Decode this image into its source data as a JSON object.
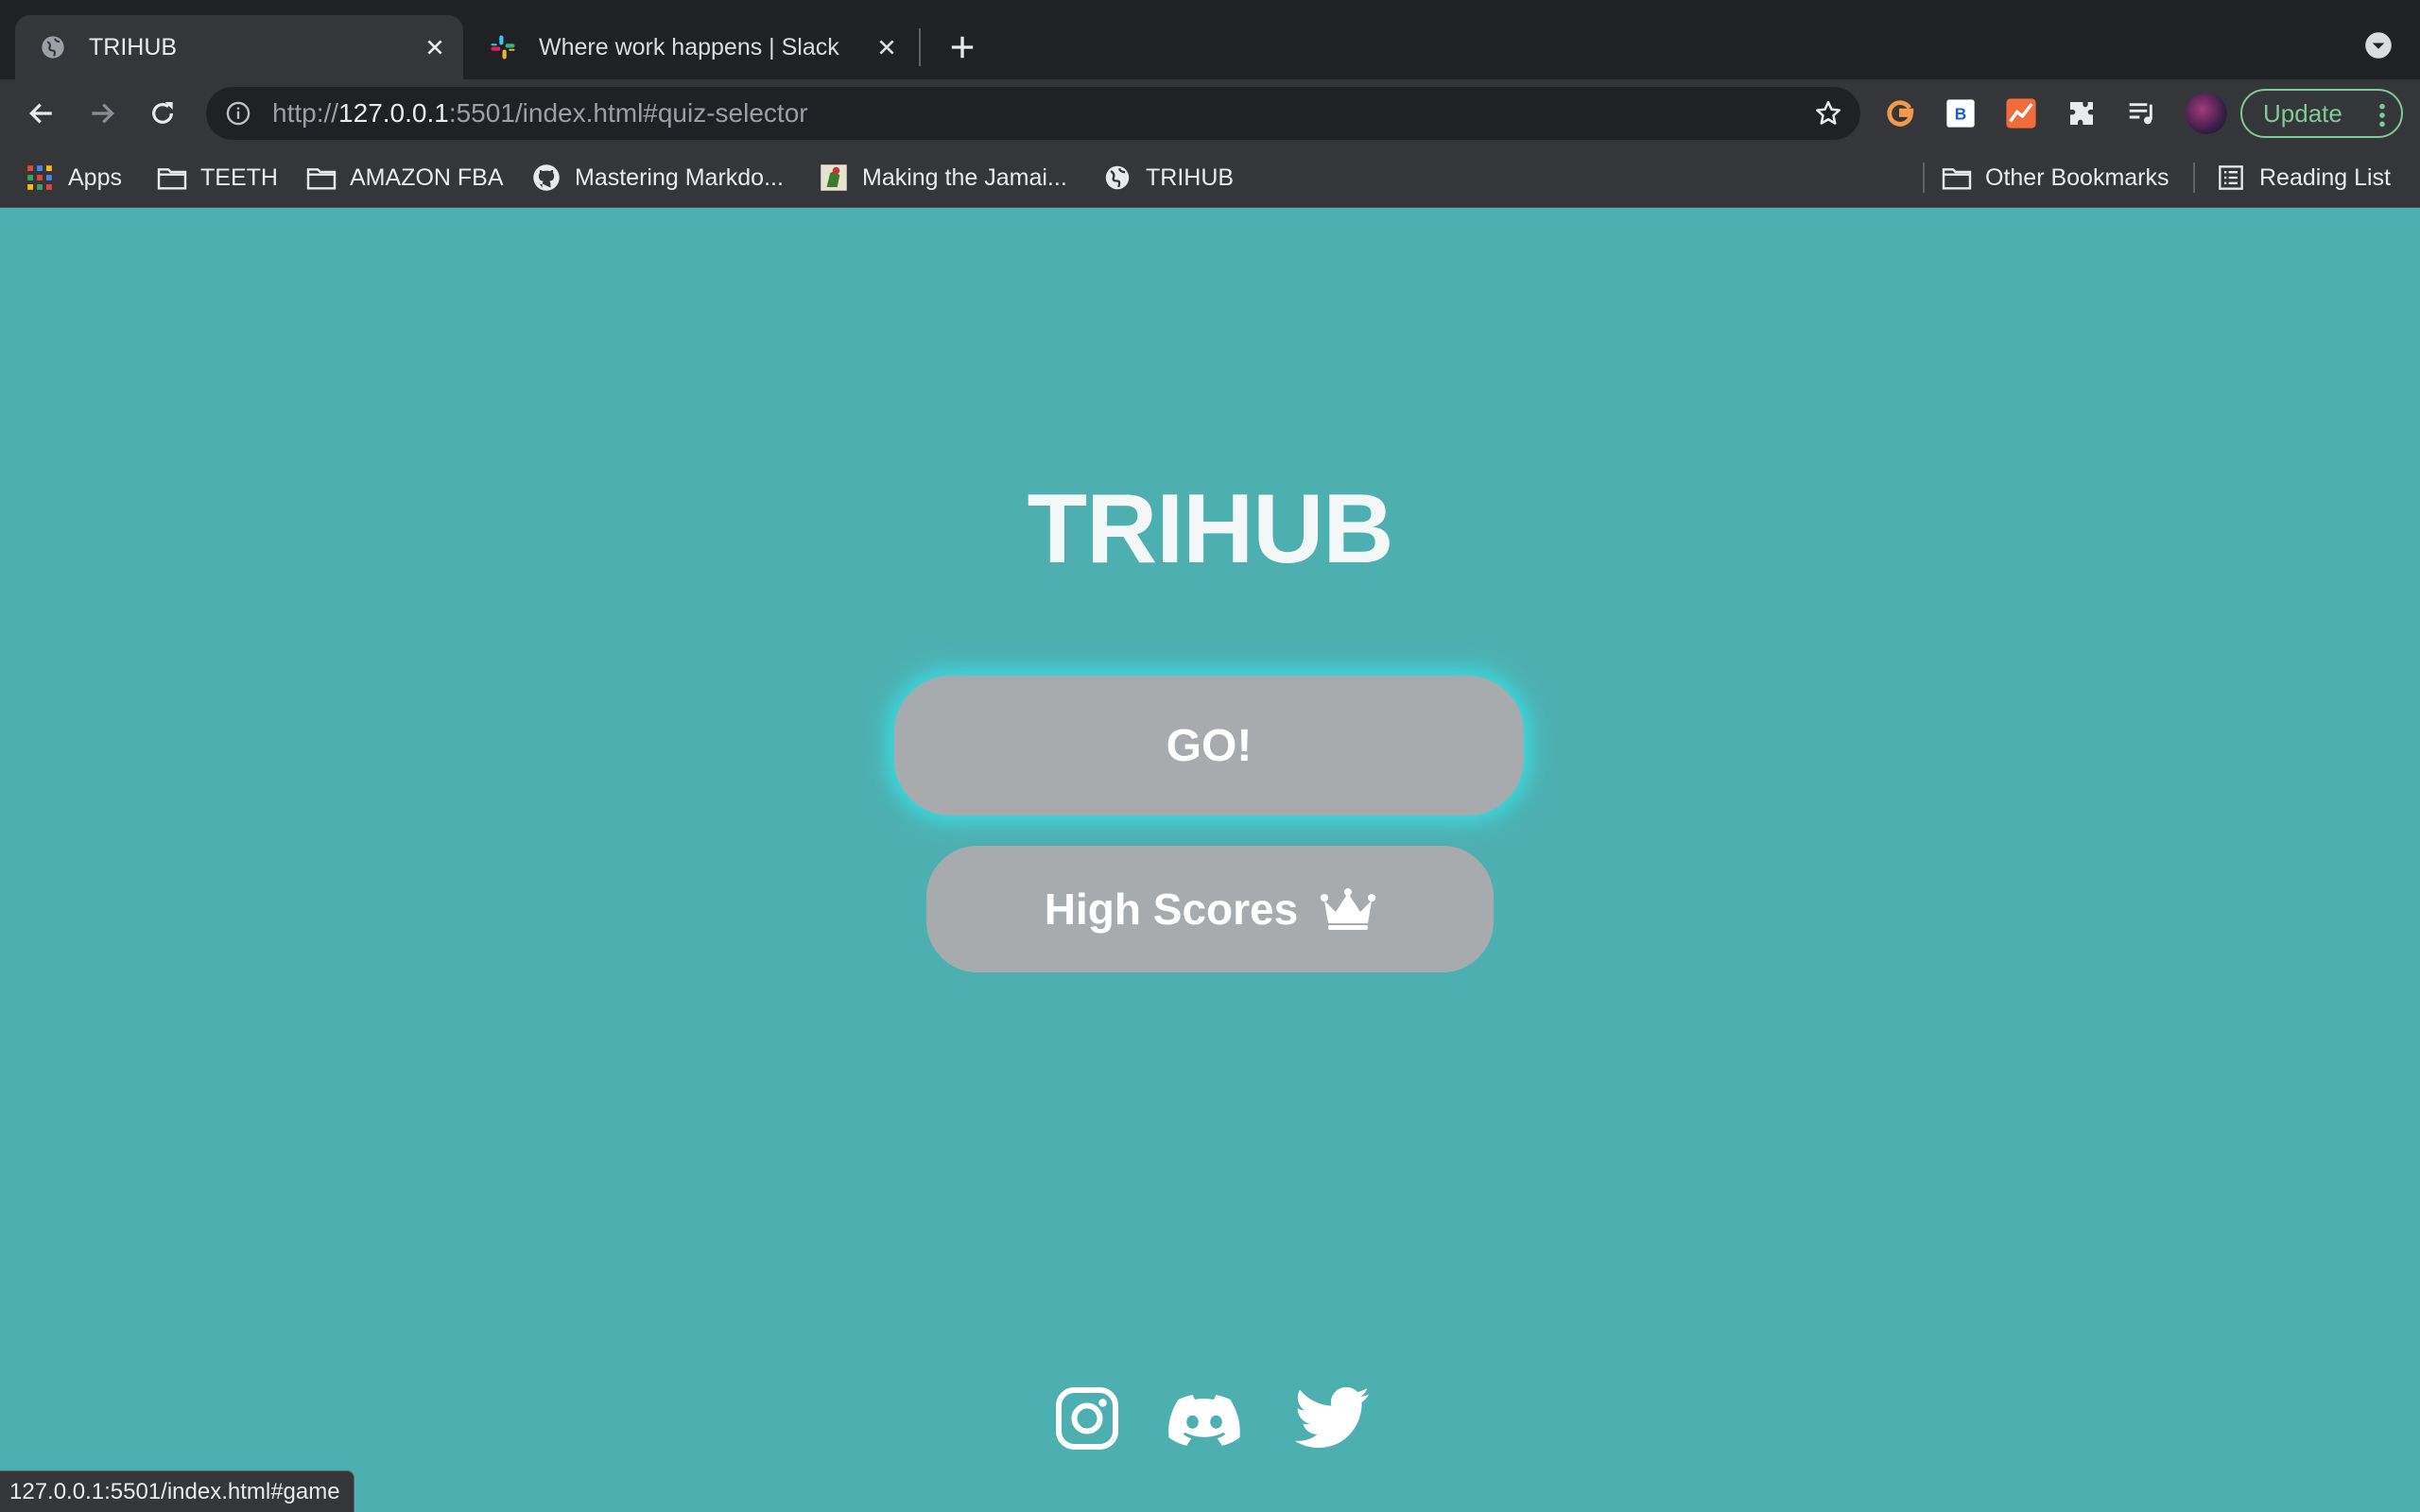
{
  "tabs": [
    {
      "title": "TRIHUB",
      "favicon": "globe-icon",
      "active": true
    },
    {
      "title": "Where work happens | Slack",
      "favicon": "slack-icon",
      "active": false
    }
  ],
  "toolbar": {
    "url_scheme": "http://",
    "url_host": "127.0.0.1",
    "url_rest": ":5501/index.html#quiz-selector",
    "update_label": "Update",
    "extensions": [
      "grammarly-icon",
      "bitwarden-icon",
      "chart-extension-icon",
      "puzzle-icon",
      "media-queue-icon"
    ]
  },
  "bookmarks": {
    "left": [
      {
        "label": "Apps",
        "icon": "apps-grid-icon"
      },
      {
        "label": "TEETH",
        "icon": "folder-icon"
      },
      {
        "label": "AMAZON FBA",
        "icon": "folder-icon"
      },
      {
        "label": "Mastering Markdo...",
        "icon": "github-icon"
      },
      {
        "label": "Making the Jamai...",
        "icon": "page-thumbnail-icon"
      },
      {
        "label": "TRIHUB",
        "icon": "globe-icon"
      }
    ],
    "right": [
      {
        "label": "Other Bookmarks",
        "icon": "folder-icon"
      },
      {
        "label": "Reading List",
        "icon": "reading-list-icon"
      }
    ]
  },
  "page": {
    "title": "TRIHUB",
    "go_label": "GO!",
    "high_scores_label": "High Scores",
    "socials": [
      "instagram-icon",
      "discord-icon",
      "twitter-icon"
    ]
  },
  "status_bar": {
    "text": "127.0.0.1:5501/index.html#game"
  },
  "colors": {
    "page_background": "#4eafb1",
    "button_background": "#a8abae",
    "go_glow": "#39e0e6",
    "update_accent": "#81c995"
  }
}
